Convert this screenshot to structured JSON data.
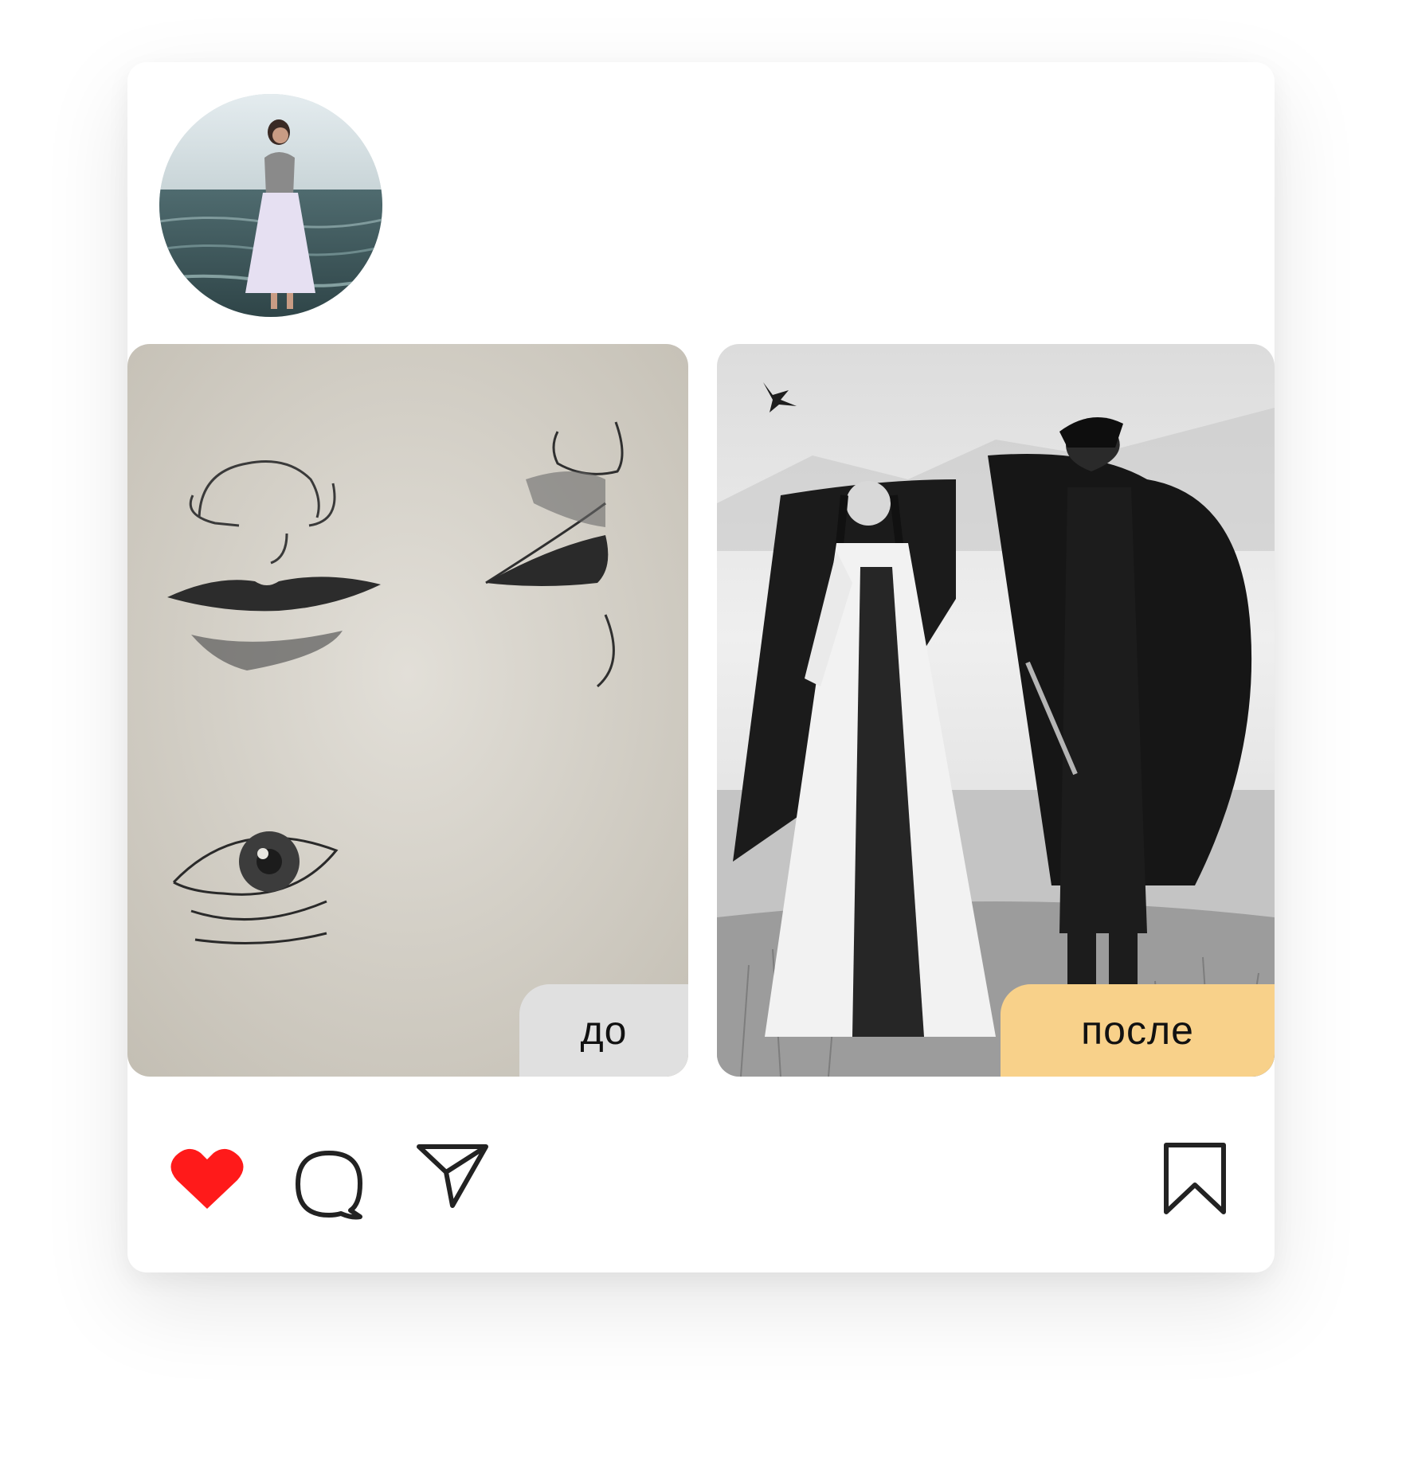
{
  "post": {
    "avatar_icon": "profile-photo",
    "photos": [
      {
        "label": "до",
        "badge_color": "#e0e0e0"
      },
      {
        "label": "после",
        "badge_color": "#f8d18a"
      }
    ]
  },
  "actions": {
    "like": {
      "icon": "heart-icon",
      "liked": true,
      "color": "#ff1a1a"
    },
    "comment": {
      "icon": "comment-icon"
    },
    "share": {
      "icon": "send-icon"
    },
    "save": {
      "icon": "bookmark-icon"
    }
  }
}
